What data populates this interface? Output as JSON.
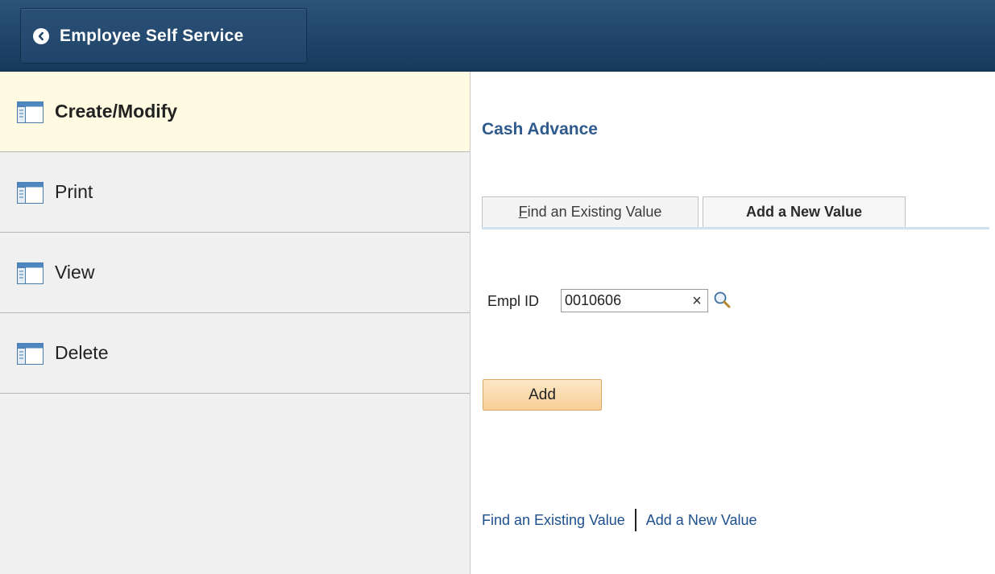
{
  "header": {
    "back_label": "Employee Self Service",
    "bg_color": "#1f4468"
  },
  "sidebar": {
    "items": [
      {
        "label": "Create/Modify",
        "icon": "page-icon",
        "selected": true
      },
      {
        "label": "Print",
        "icon": "page-icon",
        "selected": false
      },
      {
        "label": "View",
        "icon": "page-icon",
        "selected": false
      },
      {
        "label": "Delete",
        "icon": "page-icon",
        "selected": false
      }
    ],
    "selected_color": "#fffbe2"
  },
  "main": {
    "title": "Cash Advance",
    "tabs": [
      {
        "label_first": "F",
        "label_rest": "ind an Existing Value",
        "active": false
      },
      {
        "label": "Add a New Value",
        "active": true
      }
    ],
    "empl_id": {
      "label": "Empl ID",
      "value": "0010606",
      "clear_icon": "close-icon",
      "lookup_icon": "search-icon"
    },
    "add_button": "Add",
    "links": {
      "find": "Find an Existing Value",
      "add": "Add a New Value"
    }
  }
}
